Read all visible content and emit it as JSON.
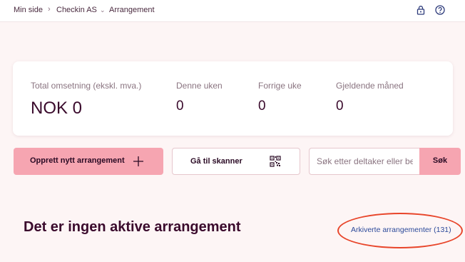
{
  "breadcrumb": {
    "items": [
      "Min side",
      "Checkin AS",
      "Arrangement"
    ]
  },
  "header_icons": {
    "lock": "lock-icon",
    "help": "help-icon"
  },
  "stats": {
    "total_label": "Total omsetning (ekskl. mva.)",
    "total_value": "NOK 0",
    "week_label": "Denne uken",
    "week_value": "0",
    "prev_week_label": "Forrige uke",
    "prev_week_value": "0",
    "month_label": "Gjeldende måned",
    "month_value": "0"
  },
  "actions": {
    "create_label": "Opprett nytt arrangement",
    "scanner_label": "Gå til skanner",
    "search_placeholder": "Søk etter deltaker eller bestilling",
    "search_button": "Søk"
  },
  "main": {
    "empty_title": "Det er ingen aktive arrangement",
    "archive_link": "Arkiverte arrangementer (131)"
  },
  "colors": {
    "background": "#fdf5f5",
    "accent_pink": "#f6a5b1",
    "text_dark": "#3a0a2c",
    "link_blue": "#2c4a9a",
    "annotation_red": "#e8452a"
  }
}
